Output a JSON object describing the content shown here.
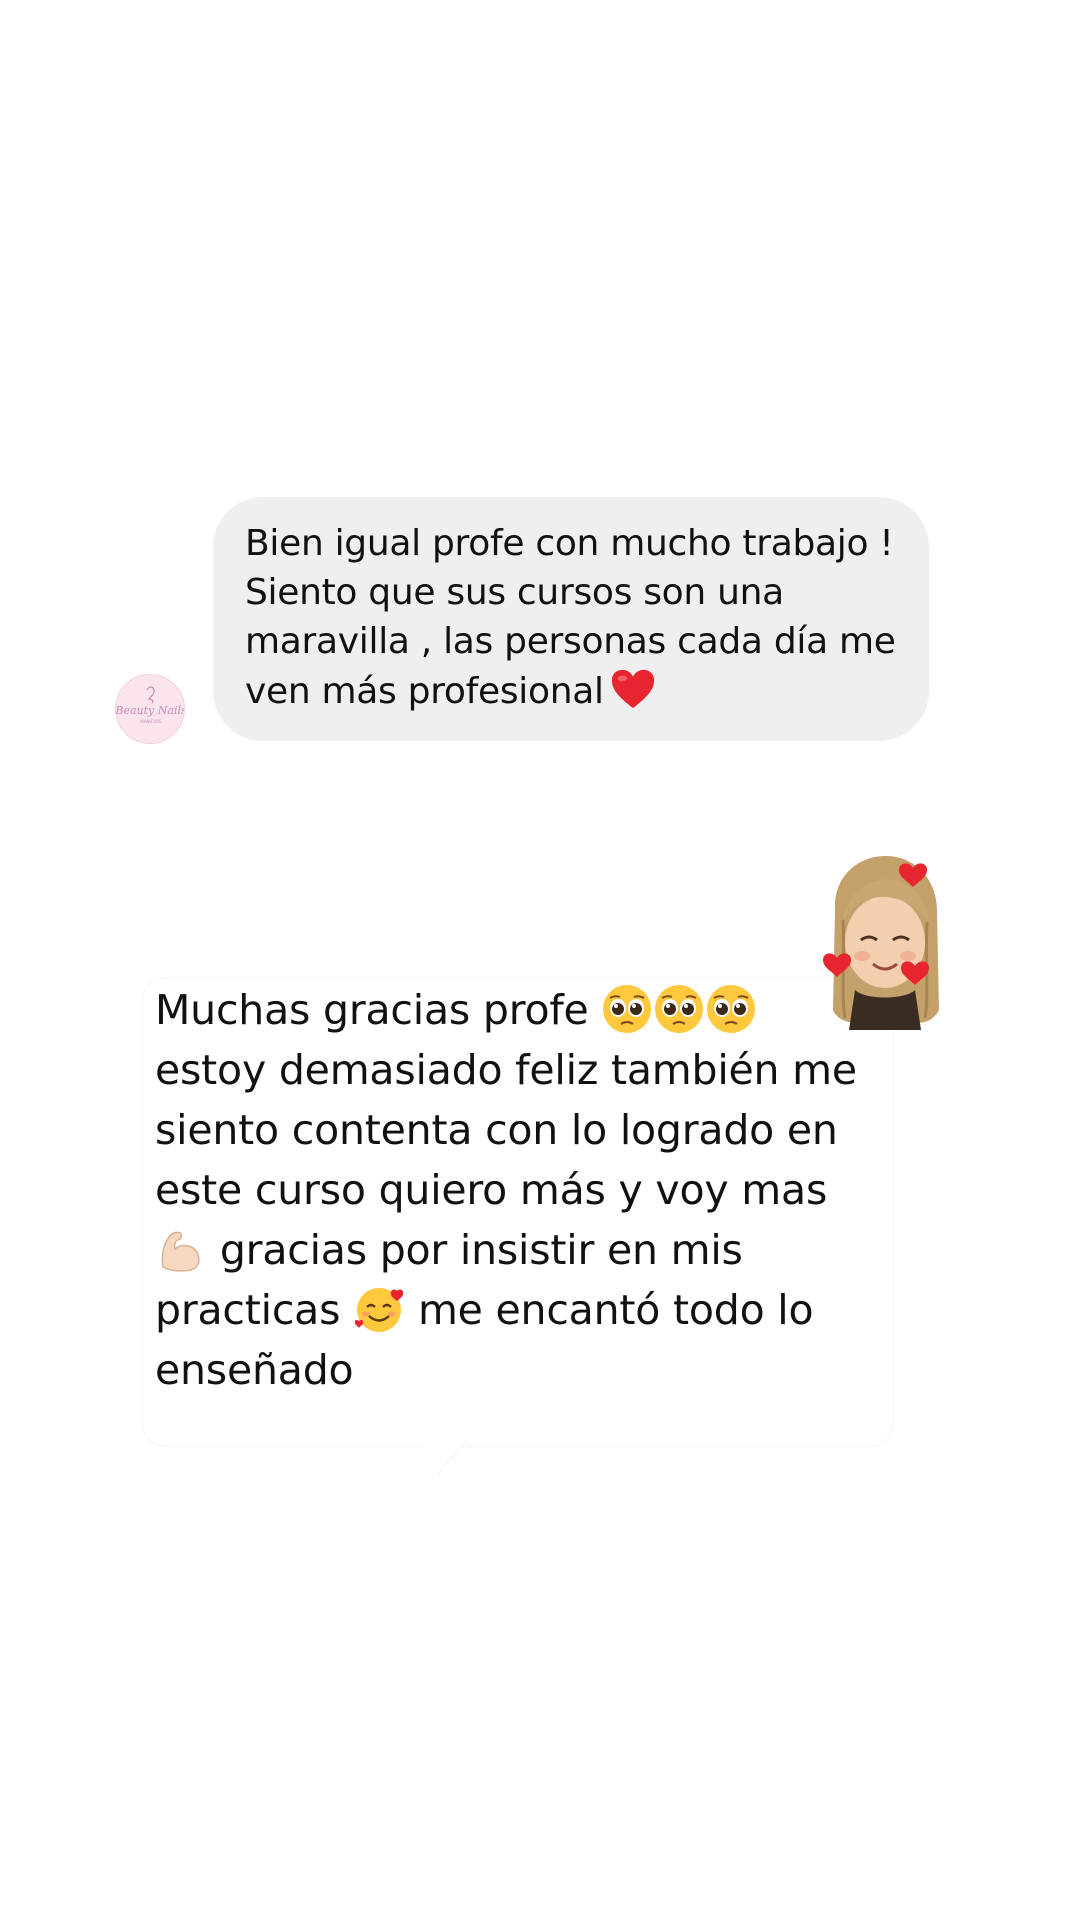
{
  "incoming": {
    "text": "Bien igual profe con mucho trabajo !\nSiento que sus cursos son una\nmaravilla , las personas cada día me\nven más profesional",
    "emoji": "heart-icon",
    "bubble_color": "#efefef"
  },
  "avatar": {
    "logo_text": "Beauty Nails",
    "logo_subtext": "MANICURE",
    "background": "#fbe4ee",
    "accent": "#c98bb7"
  },
  "reply": {
    "line1": "Muchas gracias profe",
    "line1_emojis": [
      "pleading-face-icon",
      "pleading-face-icon",
      "pleading-face-icon"
    ],
    "block1": "estoy demasiado feliz también me\nsiento contenta con lo logrado en\neste curso quiero más y voy mas",
    "line5_emoji": "flexed-biceps-icon",
    "line5": "gracias por insistir en mis",
    "line6a": "practicas",
    "line6_emoji": "smiling-face-with-hearts-icon",
    "line6b": "me encantó todo lo",
    "line7": "enseñado"
  },
  "sticker": {
    "icon": "memoji-with-hearts-icon",
    "hair_color": "#c4a06a",
    "heart_color": "#e8242f"
  }
}
